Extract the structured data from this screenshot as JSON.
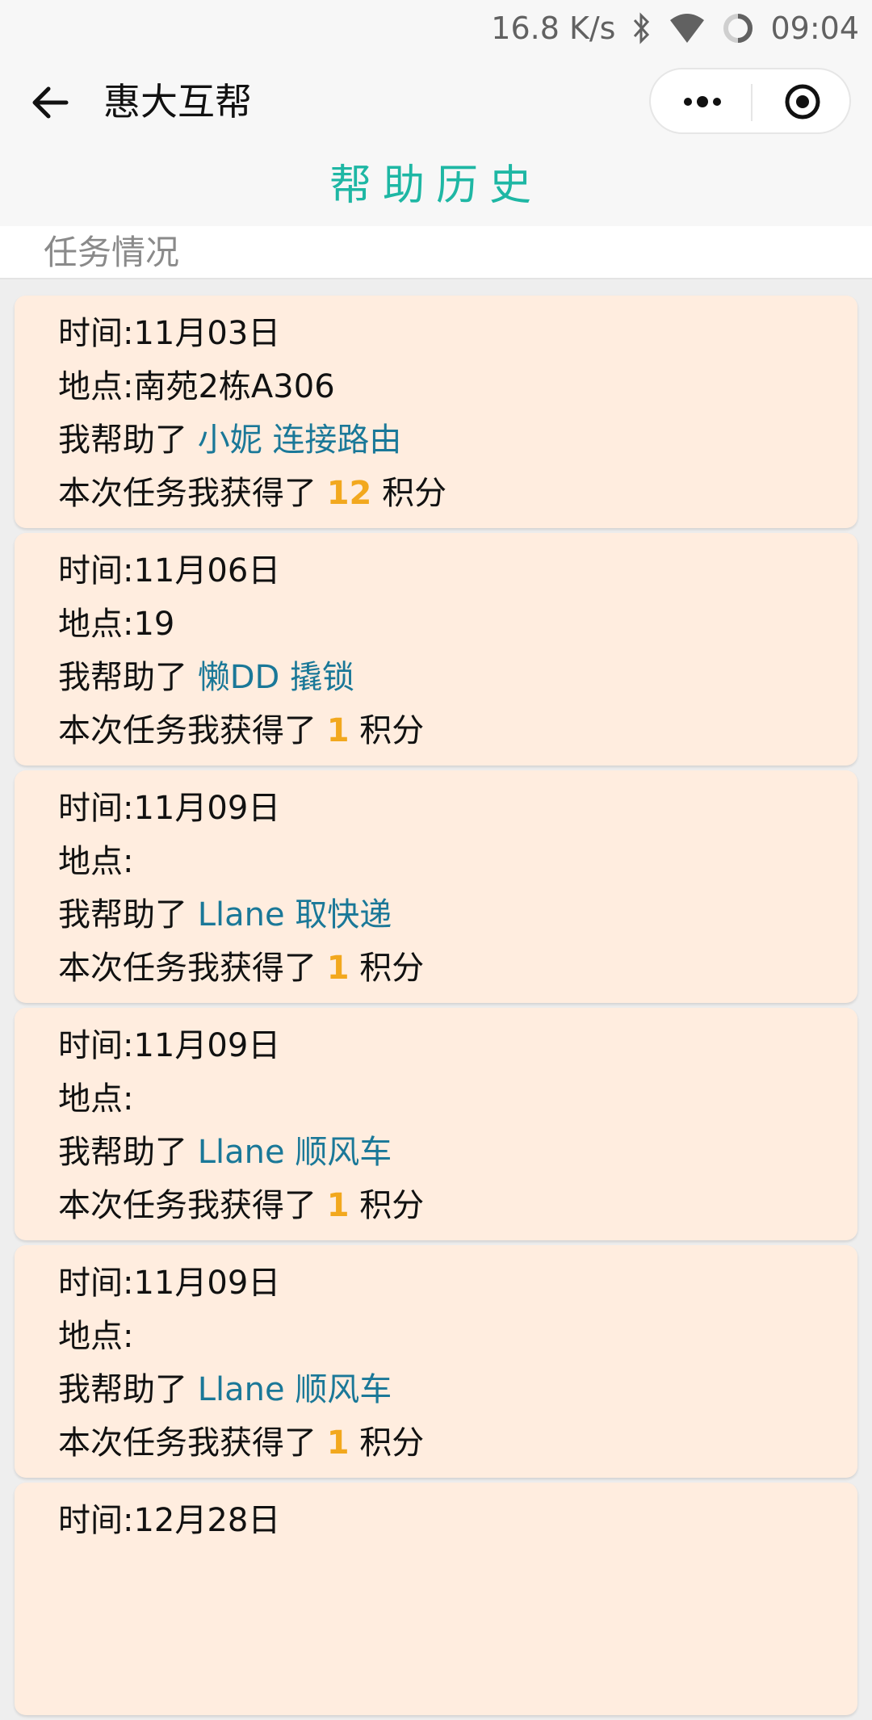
{
  "status_bar": {
    "speed": "16.8 K/s",
    "time": "09:04",
    "icons": [
      "bluetooth-icon",
      "wifi-icon",
      "sync-circle-icon"
    ]
  },
  "nav": {
    "title": "惠大互帮",
    "back_icon": "arrow-left-icon",
    "menu_icons": [
      "more-dots-icon",
      "target-circle-icon"
    ]
  },
  "page": {
    "heading": "帮助历史",
    "section_label": "任务情况"
  },
  "labels": {
    "time_prefix": "时间:",
    "location_prefix": "地点:",
    "helped_prefix": "我帮助了",
    "reward_prefix": "本次任务我获得了",
    "reward_suffix": "积分"
  },
  "records": [
    {
      "date": "11月03日",
      "location": "南苑2栋A306",
      "person": "小妮",
      "task": "连接路由",
      "points": "12"
    },
    {
      "date": "11月06日",
      "location": "19",
      "person": "懒DD",
      "task": "撬锁",
      "points": "1"
    },
    {
      "date": "11月09日",
      "location": "",
      "person": "Llane",
      "task": "取快递",
      "points": "1"
    },
    {
      "date": "11月09日",
      "location": "",
      "person": "Llane",
      "task": "顺风车",
      "points": "1"
    },
    {
      "date": "11月09日",
      "location": "",
      "person": "Llane",
      "task": "顺风车",
      "points": "1"
    },
    {
      "date": "12月28日"
    }
  ],
  "colors": {
    "accent": "#1eb7a4",
    "card_bg": "#ffeddf",
    "link": "#1a7898",
    "points": "#f2a81e"
  }
}
